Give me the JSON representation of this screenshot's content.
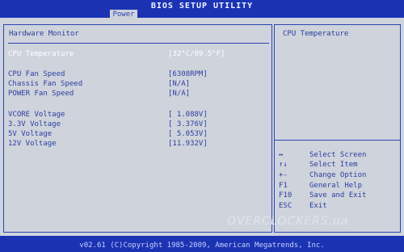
{
  "app": {
    "title": "BIOS SETUP UTILITY",
    "active_tab": "Power"
  },
  "main": {
    "section_title": "Hardware Monitor",
    "items": [
      {
        "label": "CPU Temperature",
        "value": "[32°C/89.5°F]"
      },
      {
        "label": "CPU Fan Speed",
        "value": "[6308RPM]"
      },
      {
        "label": "Chassis Fan Speed",
        "value": "[N/A]"
      },
      {
        "label": "POWER Fan Speed",
        "value": "[N/A]"
      },
      {
        "label": "VCORE  Voltage",
        "value": "[ 1.088V]"
      },
      {
        "label": "3.3V  Voltage",
        "value": "[ 3.376V]"
      },
      {
        "label": "5V  Voltage",
        "value": "[ 5.053V]"
      },
      {
        "label": "12V  Voltage",
        "value": "[11.932V]"
      }
    ]
  },
  "help": {
    "title": "CPU Temperature",
    "keys": [
      {
        "key": "↔",
        "desc": "Select Screen"
      },
      {
        "key": "↑↓",
        "desc": "Select Item"
      },
      {
        "key": "+-",
        "desc": "Change Option"
      },
      {
        "key": "F1",
        "desc": "General Help"
      },
      {
        "key": "F10",
        "desc": "Save and Exit"
      },
      {
        "key": "ESC",
        "desc": "Exit"
      }
    ]
  },
  "watermark": "OVERCLOCKERS.ua",
  "footer": "v02.61 (C)Copyright 1985-2009, American Megatrends, Inc.",
  "colors": {
    "bar": "#1b33b3",
    "panel": "#cfd3dc",
    "text": "#2b3fa0",
    "highlight": "#ffffff"
  }
}
